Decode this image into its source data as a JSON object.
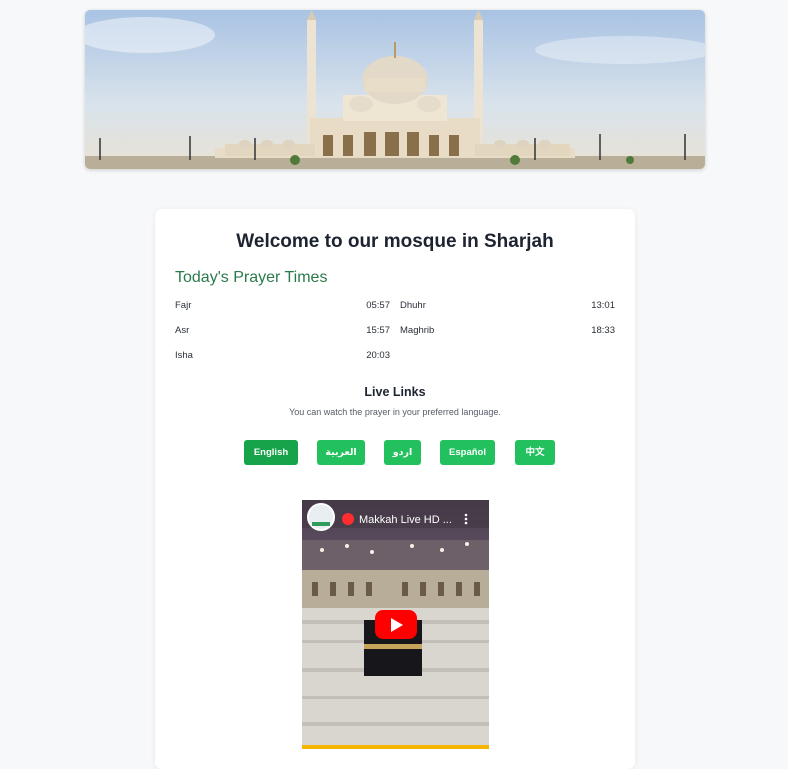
{
  "header": {
    "banner_image": "sharjah-mosque-photo"
  },
  "card": {
    "title": "Welcome to our mosque in Sharjah",
    "prayer_section_title": "Today's Prayer Times",
    "prayers": [
      {
        "name": "Fajr",
        "time": "05:57"
      },
      {
        "name": "Dhuhr",
        "time": "13:01"
      },
      {
        "name": "Asr",
        "time": "15:57"
      },
      {
        "name": "Maghrib",
        "time": "18:33"
      },
      {
        "name": "Isha",
        "time": "20:03"
      }
    ],
    "live_title": "Live Links",
    "live_description": "You can watch the prayer in your preferred language.",
    "languages": [
      {
        "label": "English",
        "active": true
      },
      {
        "label": "العربية",
        "active": false
      },
      {
        "label": "اردو",
        "active": false
      },
      {
        "label": "Español",
        "active": false
      },
      {
        "label": "中文",
        "active": false
      }
    ],
    "video": {
      "title": "Makkah Live HD ...",
      "play_icon": "play-icon",
      "menu_icon": "more-vert-icon"
    }
  },
  "colors": {
    "accent_green": "#22c15e",
    "active_green": "#16a34a",
    "section_title_green": "#2b7a4b",
    "youtube_red": "#ff0000"
  }
}
